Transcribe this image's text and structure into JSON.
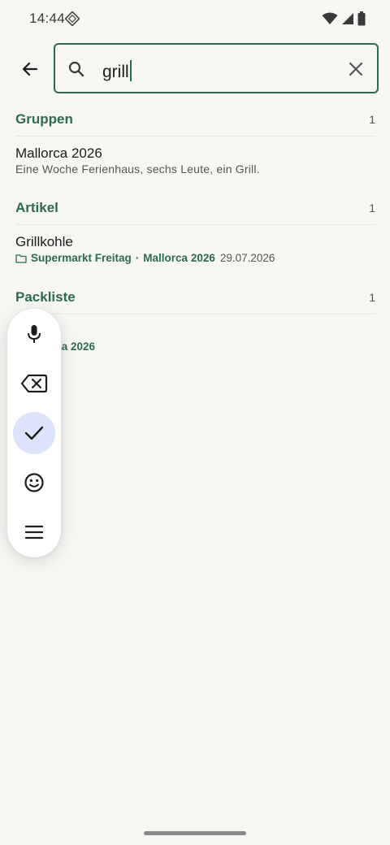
{
  "status_bar": {
    "time": "14:44",
    "app_icon": "diamond-notification-icon",
    "icons": [
      "wifi-icon",
      "signal-icon",
      "battery-icon"
    ]
  },
  "search": {
    "query": "grill",
    "back_icon": "arrow-back-icon",
    "search_icon": "search-icon",
    "clear_icon": "close-icon"
  },
  "sections": {
    "groups": {
      "title": "Gruppen",
      "count": "1",
      "items": [
        {
          "title": "Mallorca 2026",
          "subtitle": "Eine Woche Ferienhaus, sechs Leute, ein Grill."
        }
      ]
    },
    "articles": {
      "title": "Artikel",
      "count": "1",
      "items": [
        {
          "title": "Grillkohle",
          "list": "Supermarkt Freitag",
          "separator": "·",
          "group": "Mallorca 2026",
          "date": "29.07.2026"
        }
      ]
    },
    "packlist": {
      "title": "Packliste",
      "count": "1",
      "items": [
        {
          "visible_text": "rca 2026"
        }
      ]
    }
  },
  "floating_toolbar": {
    "buttons": [
      {
        "icon": "microphone-icon"
      },
      {
        "icon": "backspace-icon"
      },
      {
        "icon": "check-icon",
        "active": true
      },
      {
        "icon": "smiley-icon"
      },
      {
        "icon": "menu-icon"
      }
    ]
  },
  "colors": {
    "accent": "#2e6a4f",
    "background": "#f6f6f3",
    "active_chip": "#dde3fa"
  }
}
